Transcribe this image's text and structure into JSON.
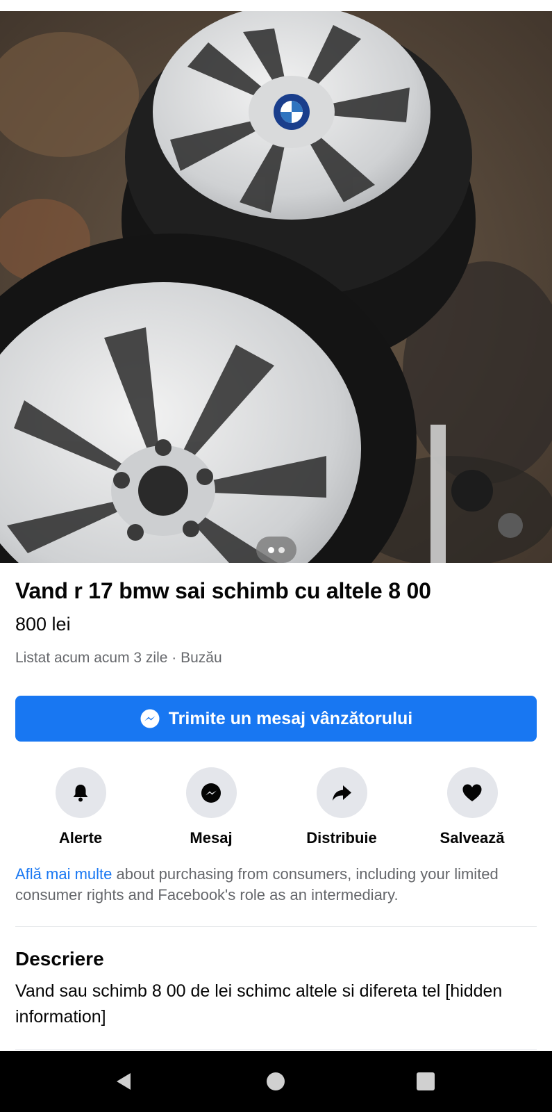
{
  "listing": {
    "title": "Vand r 17 bmw sai schimb cu altele 8 00",
    "price": "800 lei",
    "meta": "Listat acum acum 3 zile · Buzău"
  },
  "gallery": {
    "image_count": 2,
    "current_index": 1
  },
  "message_button": {
    "label": "Trimite un mesaj vânzătorului",
    "icon": "messenger-icon"
  },
  "actions": [
    {
      "label": "Alerte",
      "icon": "bell-icon"
    },
    {
      "label": "Mesaj",
      "icon": "messenger-icon"
    },
    {
      "label": "Distribuie",
      "icon": "share-icon"
    },
    {
      "label": "Salvează",
      "icon": "heart-icon"
    }
  ],
  "legal": {
    "link_text": "Află mai multe",
    "text": " about purchasing from consumers, including your limited consumer rights and Facebook's role as an intermediary."
  },
  "description": {
    "heading": "Descriere",
    "text": "Vand sau schimb 8 00 de lei schimc altele si difereta tel [hidden information]"
  },
  "colors": {
    "accent": "#1877f2",
    "text": "#050505",
    "secondary_text": "#65676b",
    "button_bg": "#e4e6eb"
  },
  "system_nav": {
    "icons": [
      "back-icon",
      "home-icon",
      "recents-icon"
    ]
  }
}
